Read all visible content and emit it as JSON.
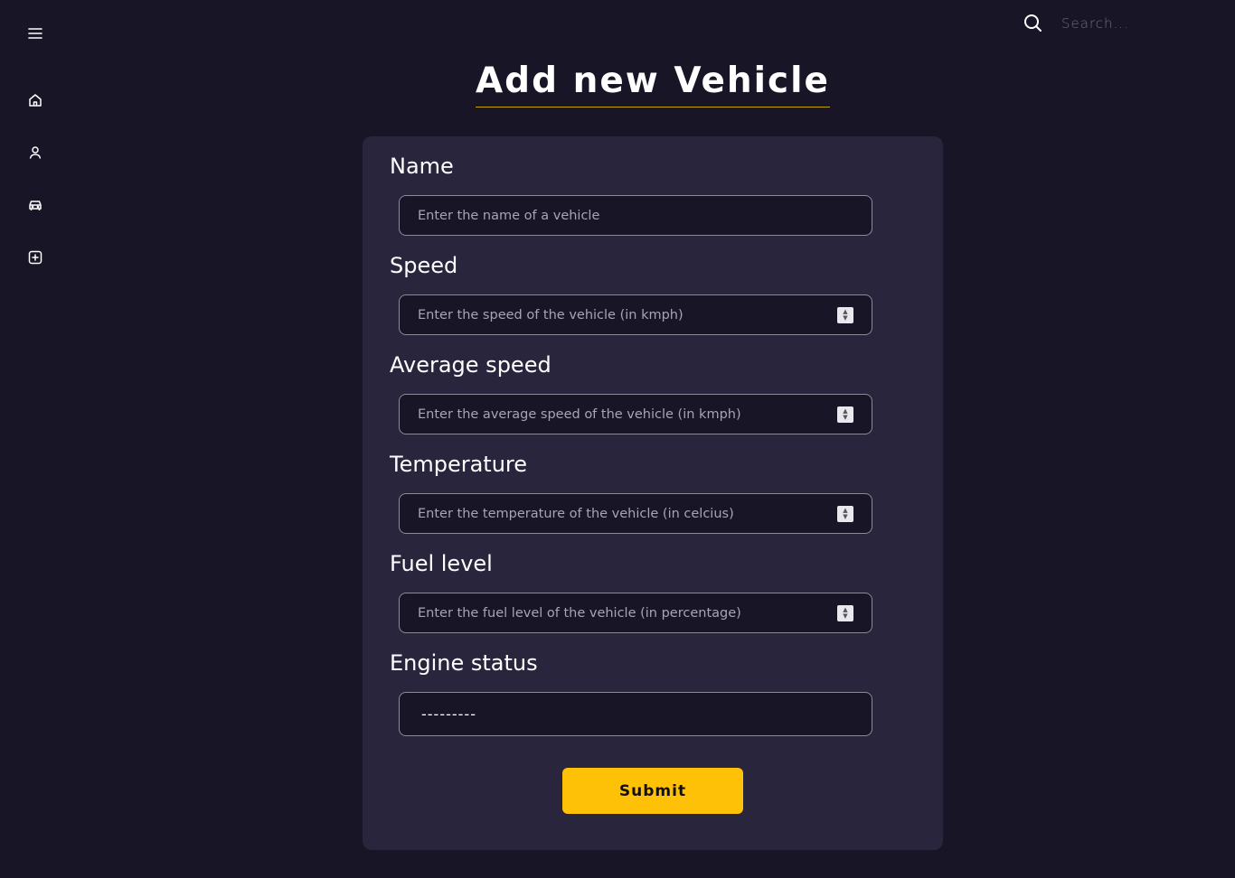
{
  "sidebar": {
    "icons": [
      "menu-icon",
      "home-icon",
      "user-icon",
      "car-icon",
      "add-square-icon"
    ]
  },
  "search": {
    "placeholder": "Search..."
  },
  "page": {
    "title": "Add new Vehicle"
  },
  "form": {
    "name": {
      "label": "Name",
      "placeholder": "Enter the name of a vehicle"
    },
    "speed": {
      "label": "Speed",
      "placeholder": "Enter the speed of the vehicle (in kmph)"
    },
    "average_speed": {
      "label": "Average speed",
      "placeholder": "Enter the average speed of the vehicle (in kmph)"
    },
    "temperature": {
      "label": "Temperature",
      "placeholder": "Enter the temperature of the vehicle (in celcius)"
    },
    "fuel_level": {
      "label": "Fuel level",
      "placeholder": "Enter the fuel level of the vehicle (in percentage)"
    },
    "engine_status": {
      "label": "Engine status",
      "selected": "---------"
    },
    "submit_label": "Submit"
  },
  "colors": {
    "background": "#181527",
    "card": "#28253d",
    "accent": "#ffc107",
    "title_underline": "#c9a400"
  }
}
